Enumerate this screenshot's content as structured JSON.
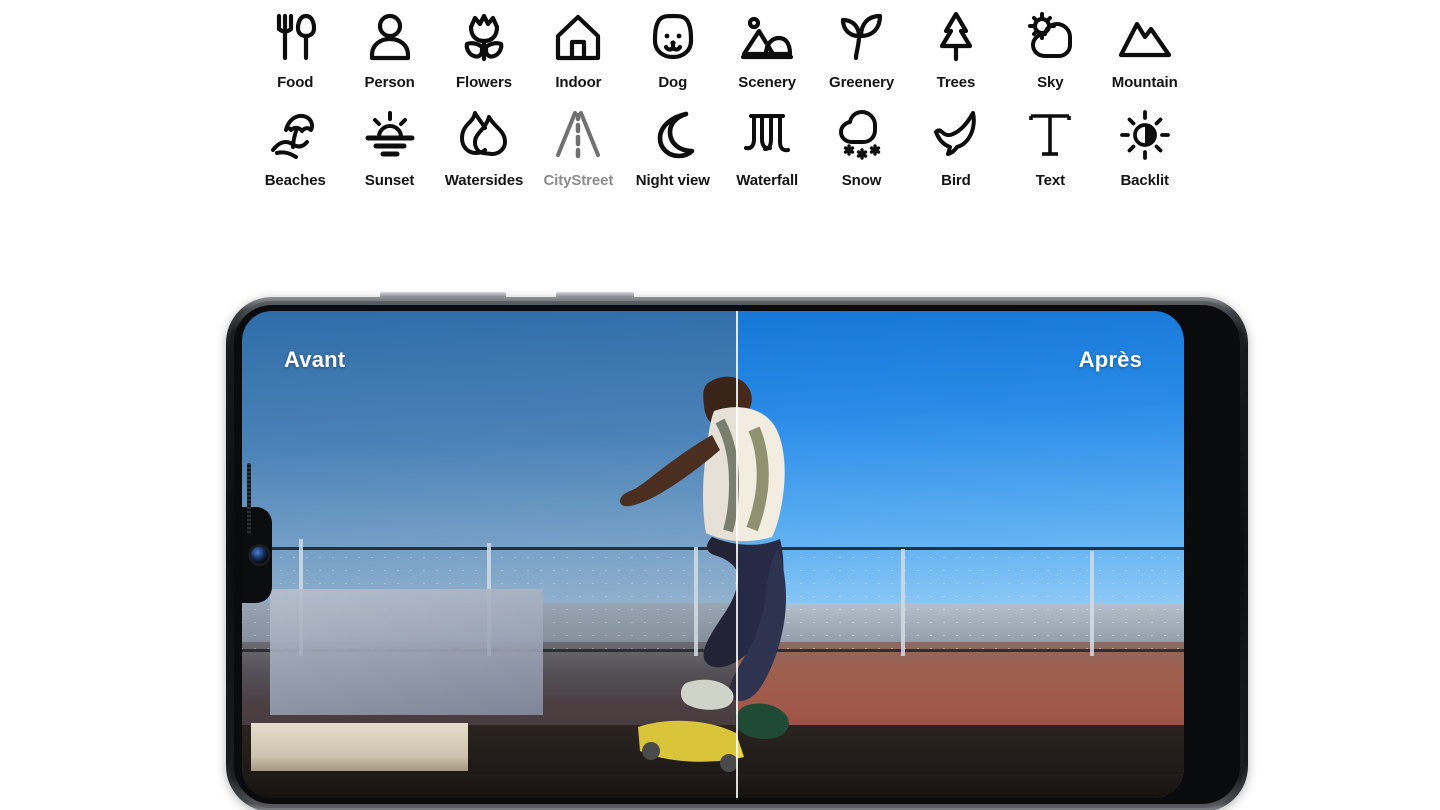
{
  "background_color": "#ffffff",
  "scene_optimizer": {
    "rows": [
      [
        {
          "icon": "food-icon",
          "label": "Food",
          "muted": false
        },
        {
          "icon": "person-icon",
          "label": "Person",
          "muted": false
        },
        {
          "icon": "flowers-icon",
          "label": "Flowers",
          "muted": false
        },
        {
          "icon": "indoor-icon",
          "label": "Indoor",
          "muted": false
        },
        {
          "icon": "dog-icon",
          "label": "Dog",
          "muted": false
        },
        {
          "icon": "scenery-icon",
          "label": "Scenery",
          "muted": false
        },
        {
          "icon": "greenery-icon",
          "label": "Greenery",
          "muted": false
        },
        {
          "icon": "trees-icon",
          "label": "Trees",
          "muted": false
        },
        {
          "icon": "sky-icon",
          "label": "Sky",
          "muted": false
        },
        {
          "icon": "mountain-icon",
          "label": "Mountain",
          "muted": false
        }
      ],
      [
        {
          "icon": "beaches-icon",
          "label": "Beaches",
          "muted": false
        },
        {
          "icon": "sunset-icon",
          "label": "Sunset",
          "muted": false
        },
        {
          "icon": "watersides-icon",
          "label": "Watersides",
          "muted": false
        },
        {
          "icon": "citystreet-icon",
          "label": "CityStreet",
          "muted": true
        },
        {
          "icon": "night-view-icon",
          "label": "Night view",
          "muted": false
        },
        {
          "icon": "waterfall-icon",
          "label": "Waterfall",
          "muted": false
        },
        {
          "icon": "snow-icon",
          "label": "Snow",
          "muted": false
        },
        {
          "icon": "bird-icon",
          "label": "Bird",
          "muted": false
        },
        {
          "icon": "text-icon",
          "label": "Text",
          "muted": false
        },
        {
          "icon": "backlit-icon",
          "label": "Backlit",
          "muted": false
        }
      ]
    ],
    "label_color": "#141414",
    "muted_label_color": "#8b8b8b"
  },
  "phone": {
    "orientation": "landscape",
    "frame_color": "#101113",
    "hardware_buttons": [
      "volume-rocker",
      "power-button"
    ],
    "front_camera": "punch-hole-waterdrop",
    "screen": {
      "comparison": {
        "before_label": "Avant",
        "after_label": "Après",
        "divider_position_percent": 52.4,
        "label_color": "#ffffff"
      },
      "photo_subject": "skateboarder performing a trick at an outdoor skate park with chain-link fence and blue sky"
    }
  }
}
